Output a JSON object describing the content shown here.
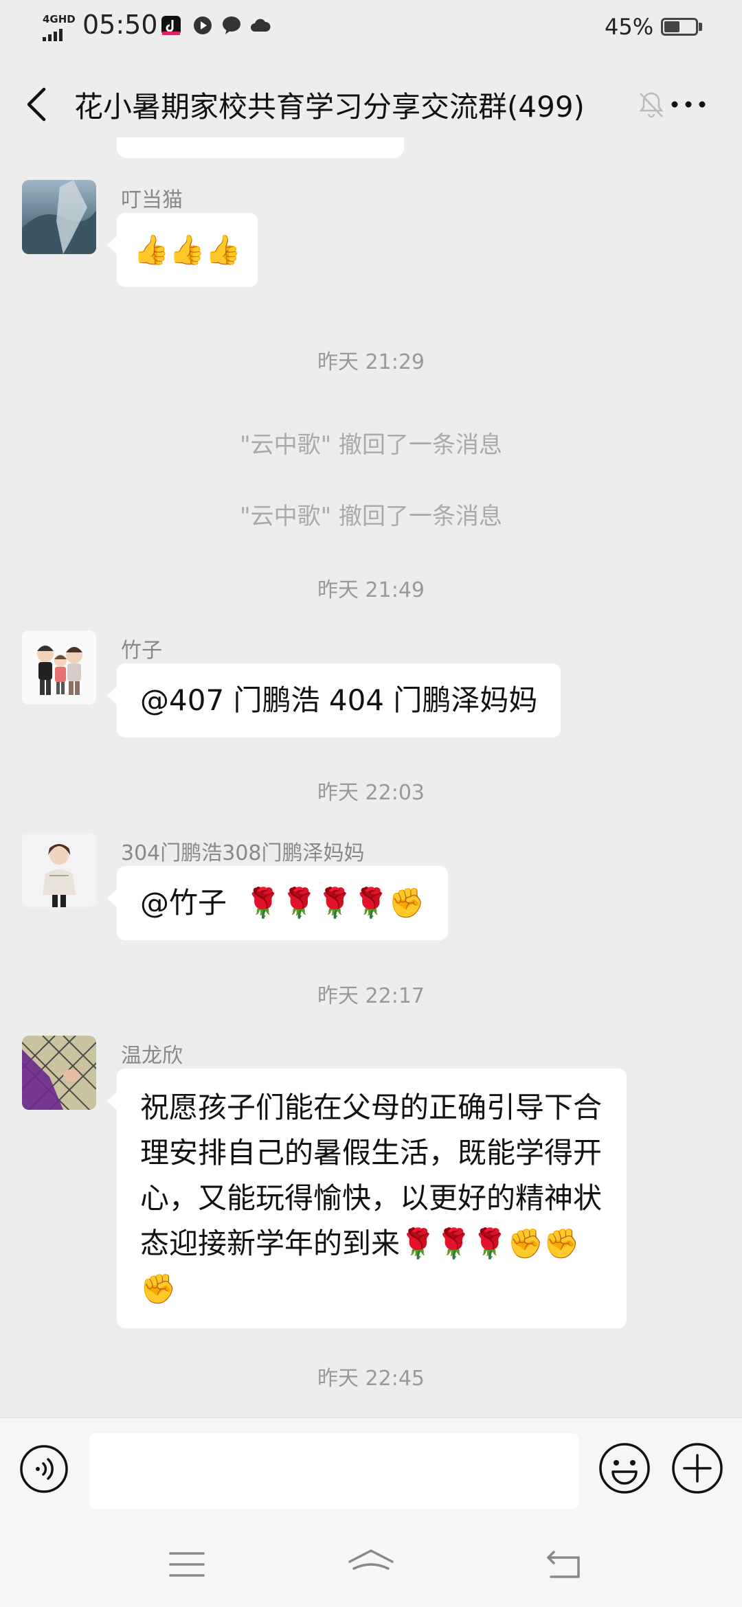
{
  "status_bar": {
    "network": "4GHD",
    "time": "05:50",
    "battery": "45%",
    "battery_level": 0.45
  },
  "header": {
    "title": "花小暑期家校共育学习分享交流群(499)"
  },
  "messages": [
    {
      "sender": "叮当猫",
      "text": "👍👍👍"
    },
    {
      "sender": "竹子",
      "text": "@407 门鹏浩 404 门鹏泽妈妈"
    },
    {
      "sender": "304门鹏浩308门鹏泽妈妈",
      "text": "@竹子  🌹🌹🌹🌹✊"
    },
    {
      "sender": "温龙欣",
      "text": "祝愿孩子们能在父母的正确引导下合理安排自己的暑假生活，既能学得开心，又能玩得愉快，以更好的精神状态迎接新学年的到来🌹🌹🌹✊✊✊"
    }
  ],
  "timestamps": [
    "昨天 21:29",
    "昨天 21:49",
    "昨天 22:03",
    "昨天 22:17",
    "昨天 22:45"
  ],
  "system_notes": [
    "\"云中歌\" 撤回了一条消息",
    "\"云中歌\" 撤回了一条消息"
  ],
  "icons": {
    "back": "chevron-left-icon",
    "mute": "bell-off-icon",
    "more": "more-icon",
    "voice": "voice-icon",
    "emoji": "emoji-icon",
    "plus": "plus-icon"
  },
  "colors": {
    "background": "#ededed",
    "bubble": "#ffffff",
    "meta_text": "#999999"
  }
}
